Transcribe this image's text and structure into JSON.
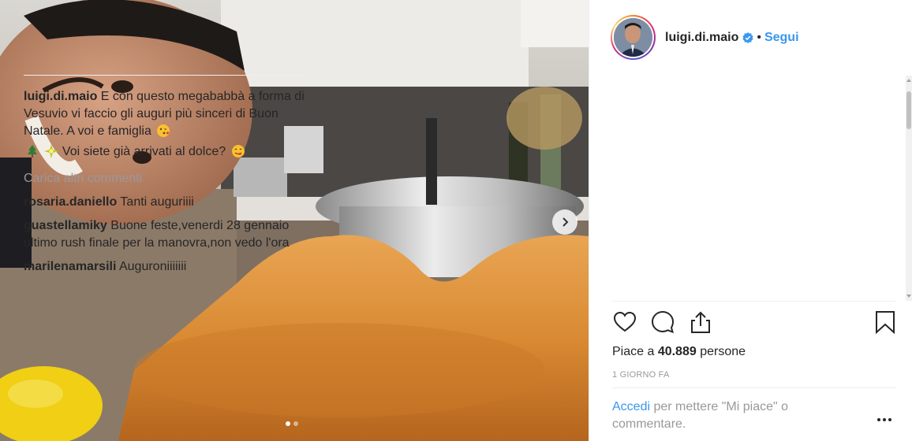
{
  "post": {
    "author": {
      "username": "luigi.di.maio",
      "verified": true,
      "follow_label": "Segui",
      "separator": "•"
    },
    "caption": {
      "username": "luigi.di.maio",
      "text_1": "E con questo megababbà a forma di Vesuvio vi faccio gli auguri più sinceri di Buon Natale. A voi e famiglia",
      "text_2": "Voi siete già arrivati al dolce?",
      "emojis": [
        "kissing-face-emoji",
        "christmas-tree-emoji",
        "sparkle-emoji",
        "yum-face-emoji"
      ]
    },
    "load_more_label": "Carica altri commenti",
    "comments": [
      {
        "username": "rosaria.daniello",
        "text": "Tanti auguriiii"
      },
      {
        "username": "guastellamiky",
        "text": "Buone feste,venerdi 28 gennaio ultimo rush finale per la manovra,non vedo l'ora"
      },
      {
        "username": "marilenamarsili",
        "text": "Auguroniiiiiii"
      }
    ],
    "likes": {
      "prefix": "Piace a ",
      "count": "40.889",
      "suffix": " persone"
    },
    "timestamp": "1 GIORNO FA",
    "footer": {
      "login_link": "Accedi",
      "text": " per mettere \"Mi piace\" o commentare."
    },
    "carousel": {
      "total": 2,
      "current": 1
    }
  },
  "colors": {
    "link": "#3897f0",
    "muted": "#999999",
    "text": "#262626",
    "verified": "#3897f0"
  },
  "icons": [
    "heart-icon",
    "comment-icon",
    "share-icon",
    "bookmark-icon",
    "more-options-icon",
    "chevron-right-icon",
    "verified-badge-icon"
  ]
}
